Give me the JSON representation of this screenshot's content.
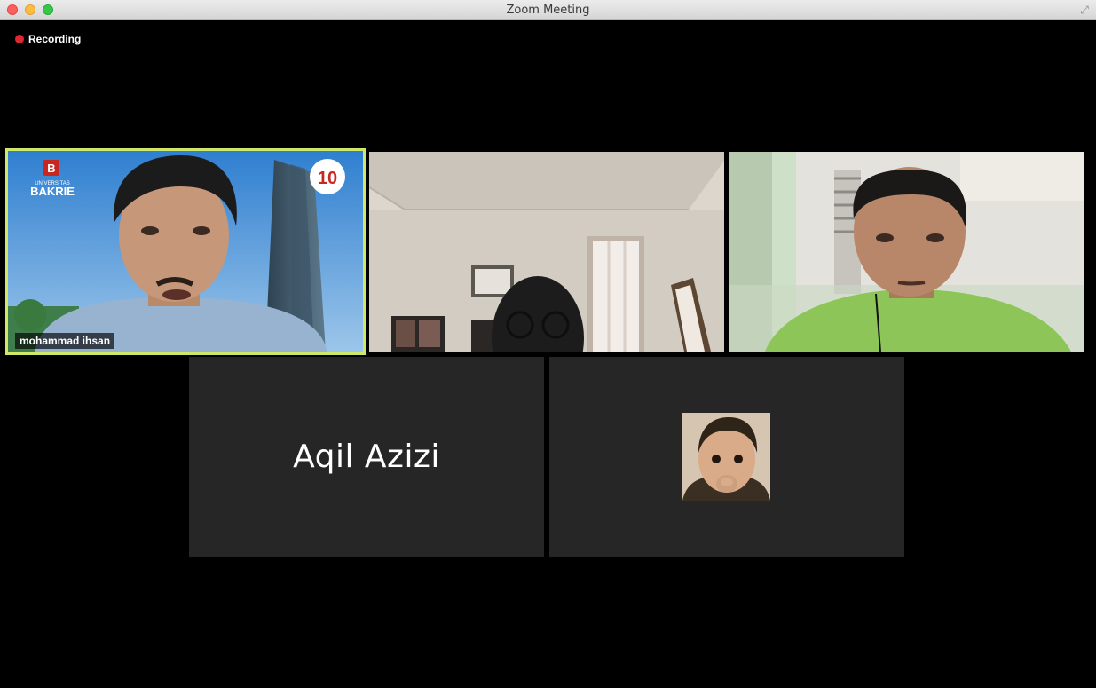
{
  "window": {
    "title": "Zoom Meeting"
  },
  "recording": {
    "label": "Recording",
    "color": "#e0262f"
  },
  "active_speaker_color": "#cfe86a",
  "participants": [
    {
      "name": "mohammad ihsan",
      "video": true,
      "active_speaker": true,
      "background": "Universitas Bakrie virtual background",
      "logo_text": "UNIVERSITAS BAKRIE"
    },
    {
      "name": "",
      "video": true,
      "active_speaker": false
    },
    {
      "name": "",
      "video": true,
      "active_speaker": false
    },
    {
      "name": "Aqil Azizi",
      "video": false,
      "active_speaker": false
    },
    {
      "name": "",
      "video": false,
      "avatar": "profile-photo",
      "active_speaker": false
    }
  ]
}
